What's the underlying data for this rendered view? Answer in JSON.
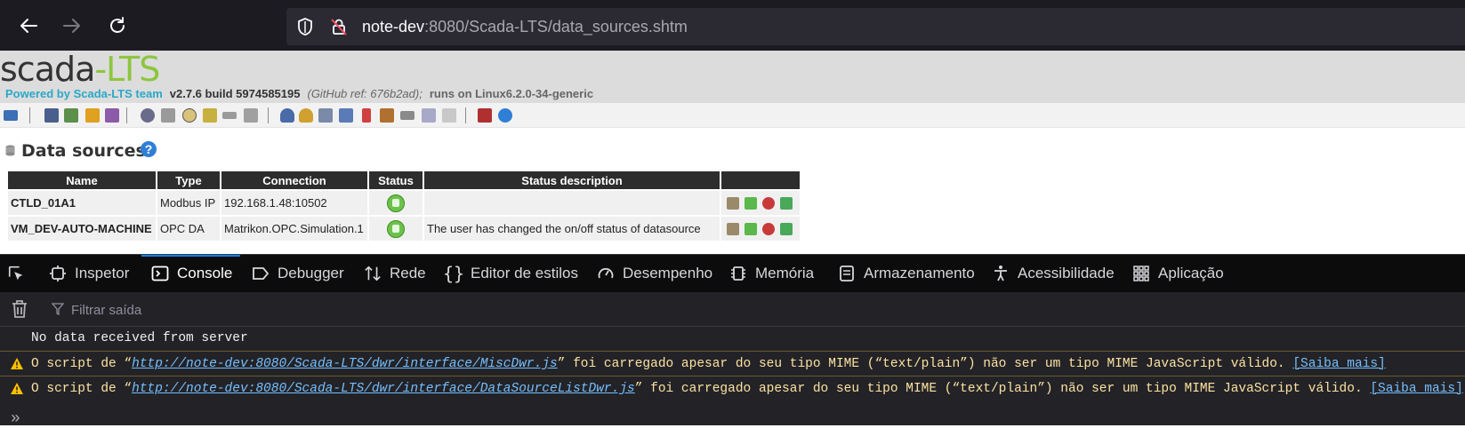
{
  "browser": {
    "url_host": "note-dev",
    "url_rest": ":8080/Scada-LTS/data_sources.shtm",
    "back_icon": "back-arrow-icon",
    "forward_icon": "forward-arrow-icon",
    "reload_icon": "reload-icon",
    "shield_icon": "tracking-protection-shield-icon",
    "insecure_icon": "insecure-lock-icon"
  },
  "header": {
    "logo_scada": "scada",
    "logo_dot": "-",
    "logo_lts": "LTS",
    "powered_by": "Powered by Scada-LTS team",
    "version": "v2.7.6 build 5974585195",
    "github": "(GitHub ref: 676b2ad);",
    "runs_on": "runs on Linux6.2.0-34-generic"
  },
  "page": {
    "title": "Data sources",
    "help_icon_text": "?"
  },
  "table": {
    "headers": [
      "Name",
      "Type",
      "Connection",
      "Status",
      "Status description",
      ""
    ],
    "rows": [
      {
        "name": "CTLD_01A1",
        "type": "Modbus IP",
        "connection": "192.168.1.48:10502",
        "status": "enabled",
        "description": ""
      },
      {
        "name": "VM_DEV-AUTO-MACHINE",
        "type": "OPC DA",
        "connection": "Matrikon.OPC.Simulation.1",
        "status": "enabled",
        "description": "The user has changed the on/off status of datasource"
      }
    ]
  },
  "devtools": {
    "tabs": [
      {
        "label": "Inspetor",
        "icon": "inspector-icon"
      },
      {
        "label": "Console",
        "icon": "console-icon"
      },
      {
        "label": "Debugger",
        "icon": "debugger-icon"
      },
      {
        "label": "Rede",
        "icon": "network-icon"
      },
      {
        "label": "Editor de estilos",
        "icon": "style-editor-icon"
      },
      {
        "label": "Desempenho",
        "icon": "performance-icon"
      },
      {
        "label": "Memória",
        "icon": "memory-icon"
      },
      {
        "label": "Armazenamento",
        "icon": "storage-icon"
      },
      {
        "label": "Acessibilidade",
        "icon": "accessibility-icon"
      },
      {
        "label": "Aplicação",
        "icon": "application-icon"
      }
    ],
    "active_tab": "Console",
    "filter_placeholder": "Filtrar saída",
    "messages": [
      {
        "level": "log",
        "text": "No data received from server"
      },
      {
        "level": "warn",
        "prefix": "O script de “",
        "link": "http://note-dev:8080/Scada-LTS/dwr/interface/MiscDwr.js",
        "suffix": "” foi carregado apesar do seu tipo MIME (“text/plain”) não ser um tipo MIME JavaScript válido. ",
        "more": "[Saiba mais]"
      },
      {
        "level": "warn",
        "prefix": "O script de “",
        "link": "http://note-dev:8080/Scada-LTS/dwr/interface/DataSourceListDwr.js",
        "suffix": "” foi carregado apesar do seu tipo MIME (“text/plain”) não ser um tipo MIME JavaScript válido. ",
        "more": "[Saiba mais]"
      }
    ],
    "prompt": "»"
  }
}
